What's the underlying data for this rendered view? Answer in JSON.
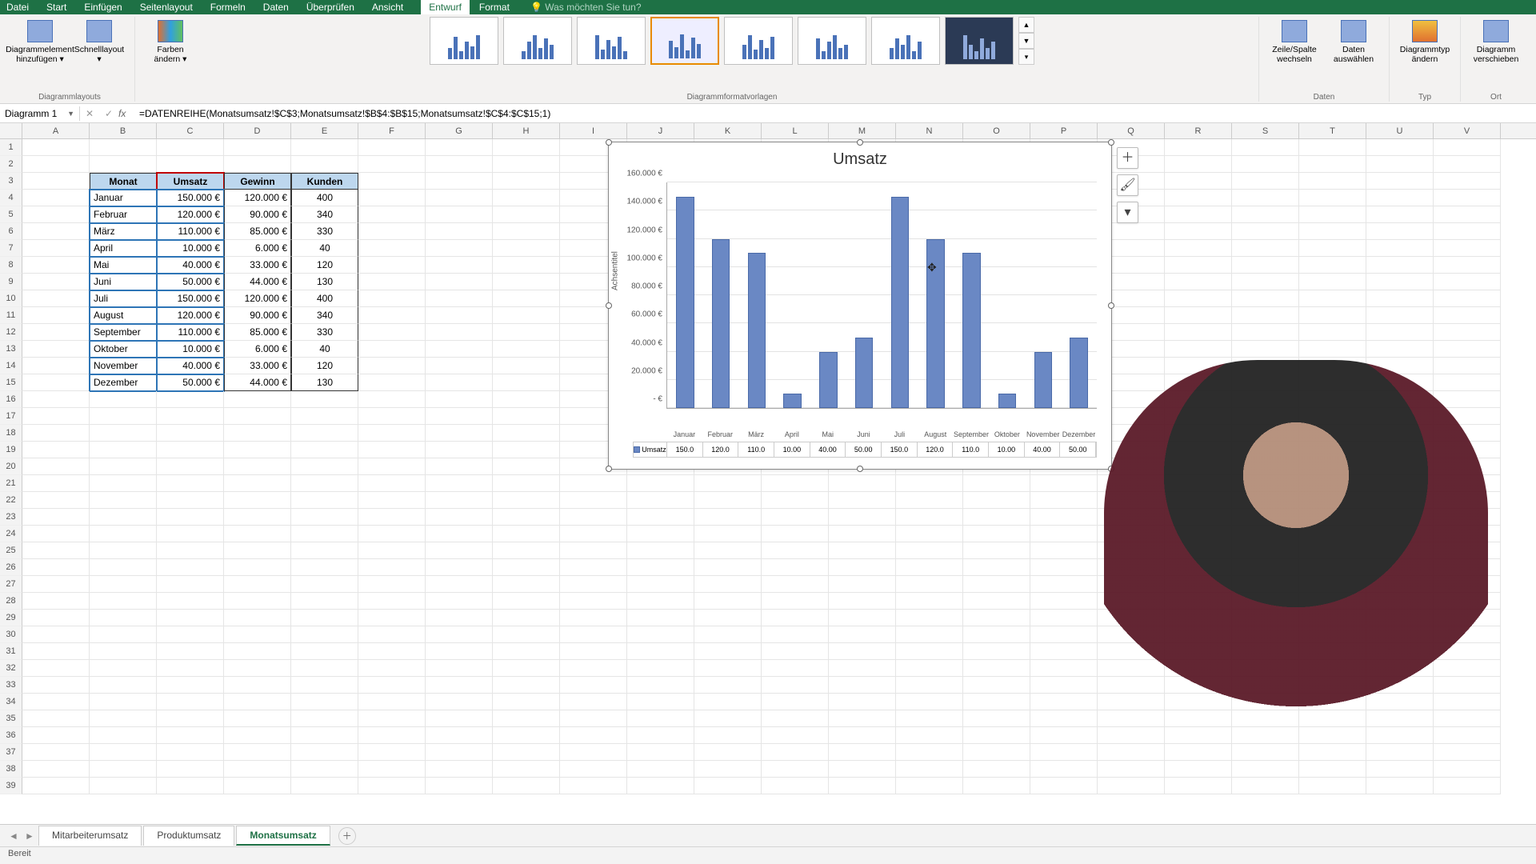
{
  "menu": {
    "items": [
      "Datei",
      "Start",
      "Einfügen",
      "Seitenlayout",
      "Formeln",
      "Daten",
      "Überprüfen",
      "Ansicht",
      "Entwurf",
      "Format"
    ],
    "active": "Entwurf",
    "search_hint": "Was möchten Sie tun?"
  },
  "ribbon": {
    "group_layouts": "Diagrammlayouts",
    "group_styles": "Diagrammformatvorlagen",
    "group_data": "Daten",
    "group_type": "Typ",
    "group_loc": "Ort",
    "btn_add_element": "Diagrammelement hinzufügen ▾",
    "btn_quick_layout": "Schnelllayout ▾",
    "btn_colors": "Farben ändern ▾",
    "btn_switch": "Zeile/Spalte wechseln",
    "btn_select_data": "Daten auswählen",
    "btn_change_type": "Diagrammtyp ändern",
    "btn_move_chart": "Diagramm verschieben"
  },
  "formula": {
    "name_box": "Diagramm 1",
    "formula": "=DATENREIHE(Monatsumsatz!$C$3;Monatsumsatz!$B$4:$B$15;Monatsumsatz!$C$4:$C$15;1)"
  },
  "columns": [
    "A",
    "B",
    "C",
    "D",
    "E",
    "F",
    "G",
    "H",
    "I",
    "J",
    "K",
    "L",
    "M",
    "N",
    "O",
    "P",
    "Q",
    "R",
    "S",
    "T",
    "U",
    "V"
  ],
  "table": {
    "headers": [
      "Monat",
      "Umsatz",
      "Gewinn",
      "Kunden"
    ],
    "rows": [
      {
        "monat": "Januar",
        "umsatz": "150.000 €",
        "gewinn": "120.000 €",
        "kunden": "400"
      },
      {
        "monat": "Februar",
        "umsatz": "120.000 €",
        "gewinn": "90.000 €",
        "kunden": "340"
      },
      {
        "monat": "März",
        "umsatz": "110.000 €",
        "gewinn": "85.000 €",
        "kunden": "330"
      },
      {
        "monat": "April",
        "umsatz": "10.000 €",
        "gewinn": "6.000 €",
        "kunden": "40"
      },
      {
        "monat": "Mai",
        "umsatz": "40.000 €",
        "gewinn": "33.000 €",
        "kunden": "120"
      },
      {
        "monat": "Juni",
        "umsatz": "50.000 €",
        "gewinn": "44.000 €",
        "kunden": "130"
      },
      {
        "monat": "Juli",
        "umsatz": "150.000 €",
        "gewinn": "120.000 €",
        "kunden": "400"
      },
      {
        "monat": "August",
        "umsatz": "120.000 €",
        "gewinn": "90.000 €",
        "kunden": "340"
      },
      {
        "monat": "September",
        "umsatz": "110.000 €",
        "gewinn": "85.000 €",
        "kunden": "330"
      },
      {
        "monat": "Oktober",
        "umsatz": "10.000 €",
        "gewinn": "6.000 €",
        "kunden": "40"
      },
      {
        "monat": "November",
        "umsatz": "40.000 €",
        "gewinn": "33.000 €",
        "kunden": "120"
      },
      {
        "monat": "Dezember",
        "umsatz": "50.000 €",
        "gewinn": "44.000 €",
        "kunden": "130"
      }
    ]
  },
  "chart": {
    "title": "Umsatz",
    "y_axis_title": "Achsentitel",
    "yticks": [
      "-   €",
      "20.000 €",
      "40.000 €",
      "60.000 €",
      "80.000 €",
      "100.000 €",
      "120.000 €",
      "140.000 €",
      "160.000 €"
    ],
    "legend_label": "Umsatz",
    "xshort": [
      "Januar",
      "Februar",
      "März",
      "April",
      "Mai",
      "Juni",
      "Juli",
      "August",
      "September",
      "Oktober",
      "November",
      "Dezember"
    ],
    "data_row": [
      "150.0",
      "120.0",
      "110.0",
      "10.00",
      "40.00",
      "50.00",
      "150.0",
      "120.0",
      "110.0",
      "10.00",
      "40.00",
      "50.00"
    ]
  },
  "chart_data": {
    "type": "bar",
    "title": "Umsatz",
    "xlabel": "",
    "ylabel": "Achsentitel",
    "ylim": [
      0,
      160000
    ],
    "categories": [
      "Januar",
      "Februar",
      "März",
      "April",
      "Mai",
      "Juni",
      "Juli",
      "August",
      "September",
      "Oktober",
      "November",
      "Dezember"
    ],
    "series": [
      {
        "name": "Umsatz",
        "values": [
          150000,
          120000,
          110000,
          10000,
          40000,
          50000,
          150000,
          120000,
          110000,
          10000,
          40000,
          50000
        ]
      }
    ]
  },
  "sheets": {
    "tabs": [
      "Mitarbeiterumsatz",
      "Produktumsatz",
      "Monatsumsatz"
    ],
    "active": "Monatsumsatz"
  },
  "status": "Bereit"
}
